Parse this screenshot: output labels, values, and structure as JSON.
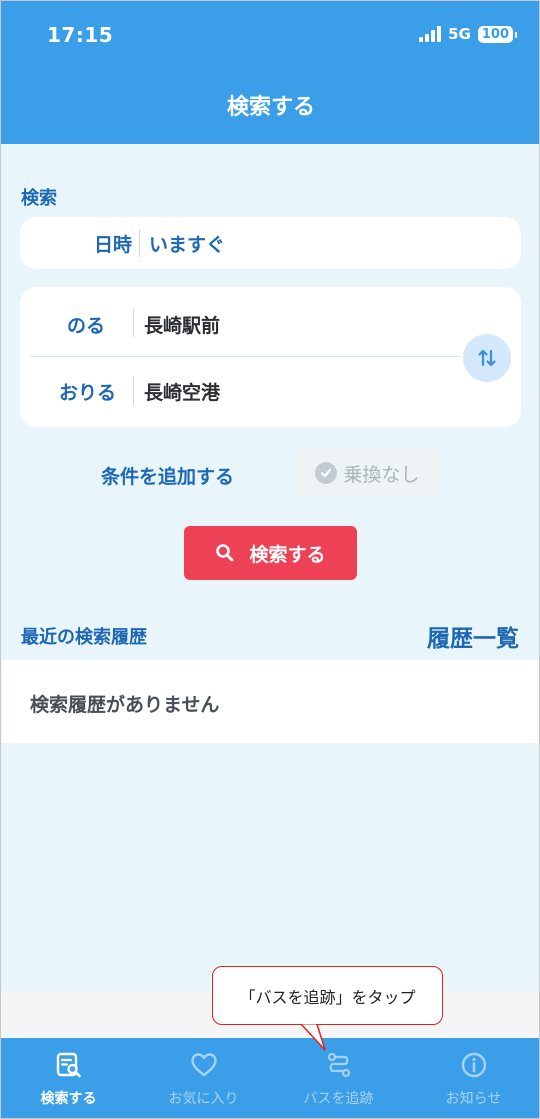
{
  "status_bar": {
    "time": "17:15",
    "network": "5G",
    "battery": "100"
  },
  "header": {
    "title": "検索する"
  },
  "search": {
    "section_label": "検索",
    "date_label": "日時",
    "date_value": "いますぐ",
    "board_label": "のる",
    "board_value": "長崎駅前",
    "alight_label": "おりる",
    "alight_value": "長崎空港",
    "swap_icon": "swap-vertical-icon",
    "add_condition": "条件を追加する",
    "transfer_chip": "乗換なし",
    "search_button": "検索する"
  },
  "recent": {
    "title": "最近の検索履歴",
    "list_link": "履歴一覧",
    "empty_message": "検索履歴がありません"
  },
  "callout": {
    "text": "「バスを追跡」をタップ"
  },
  "tabs": [
    {
      "label": "検索する",
      "icon": "search-list-icon",
      "active": true
    },
    {
      "label": "お気に入り",
      "icon": "heart-icon",
      "active": false
    },
    {
      "label": "バスを追跡",
      "icon": "route-icon",
      "active": false
    },
    {
      "label": "お知らせ",
      "icon": "info-icon",
      "active": false
    }
  ],
  "colors": {
    "primary": "#3a9fe8",
    "link": "#1e68b3",
    "search_button": "#ef4155",
    "background": "#e8f5fb",
    "callout_border": "#e2221f"
  }
}
